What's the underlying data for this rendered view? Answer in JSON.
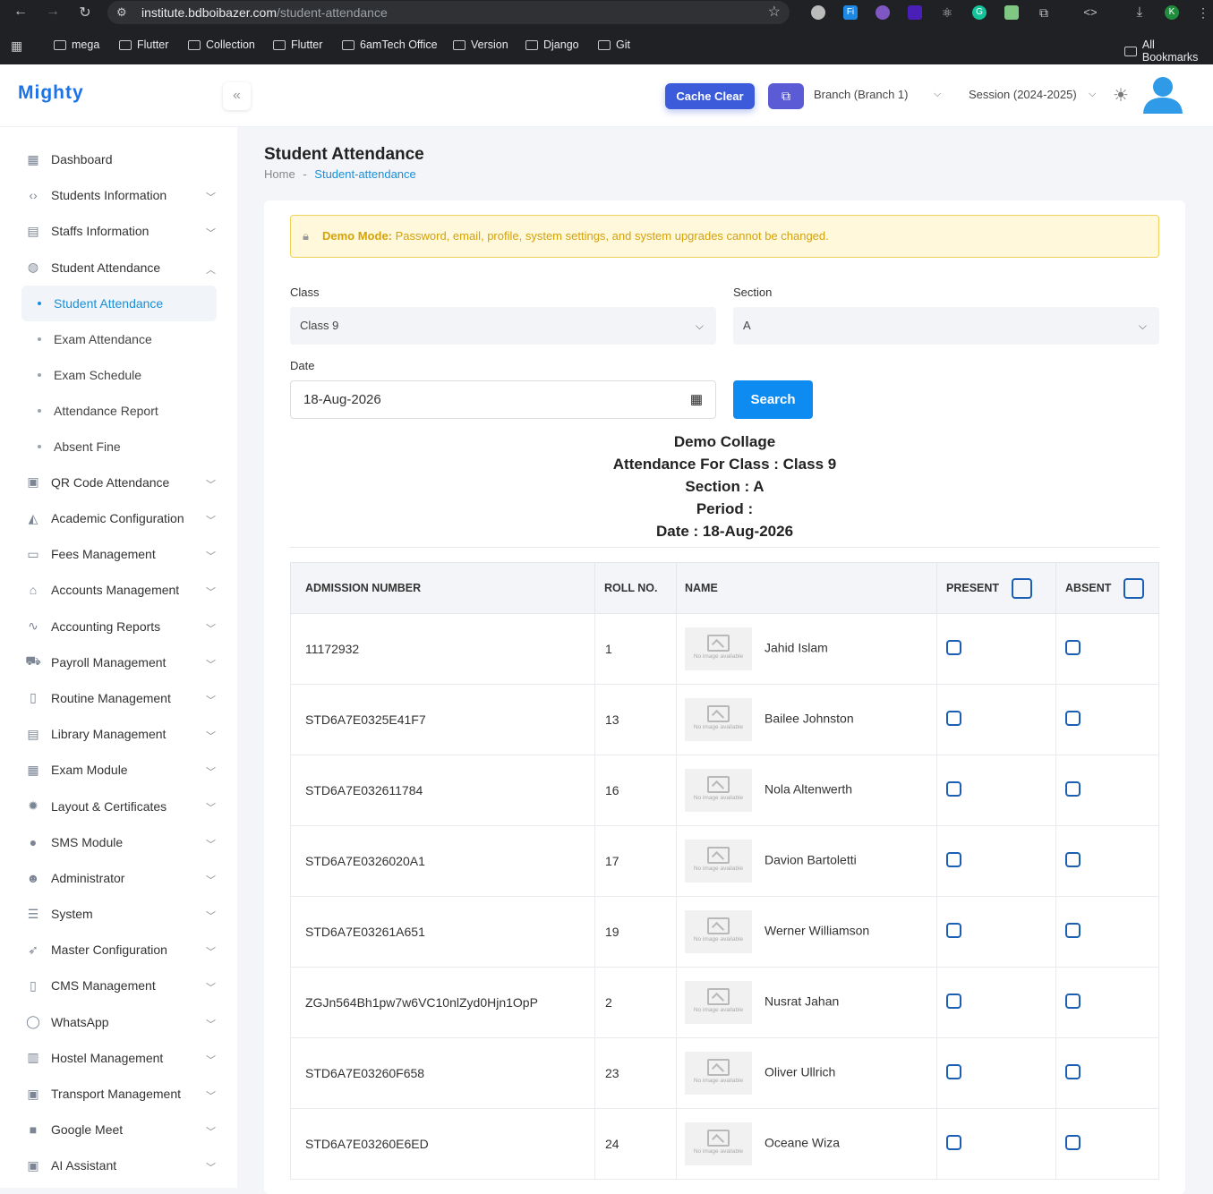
{
  "browser": {
    "url_host": "institute.bdboibazer.com",
    "url_path": "/student-attendance",
    "profile_initial": "K",
    "bookmarks": [
      "mega",
      "Flutter",
      "Collection",
      "Flutter",
      "6amTech Office",
      "Version",
      "Django",
      "Git"
    ],
    "all_bookmarks": "All Bookmarks"
  },
  "app": {
    "logo": "Mighty"
  },
  "sidebar": {
    "items": [
      {
        "label": "Dashboard",
        "icon": "dashboard-icon",
        "chevron": false
      },
      {
        "label": "Students Information",
        "icon": "code-icon",
        "chevron": true
      },
      {
        "label": "Staffs Information",
        "icon": "staff-icon",
        "chevron": true
      },
      {
        "label": "Student Attendance",
        "icon": "attendance-icon",
        "chevron": true,
        "expanded": true
      },
      {
        "label": "QR Code Attendance",
        "icon": "qr-icon",
        "chevron": true
      },
      {
        "label": "Academic Configuration",
        "icon": "academic-icon",
        "chevron": true
      },
      {
        "label": "Fees Management",
        "icon": "fees-icon",
        "chevron": true
      },
      {
        "label": "Accounts Management",
        "icon": "bank-icon",
        "chevron": true
      },
      {
        "label": "Accounting Reports",
        "icon": "chart-icon",
        "chevron": true
      },
      {
        "label": "Payroll Management",
        "icon": "payroll-icon",
        "chevron": true
      },
      {
        "label": "Routine Management",
        "icon": "map-icon",
        "chevron": true
      },
      {
        "label": "Library Management",
        "icon": "library-icon",
        "chevron": true
      },
      {
        "label": "Exam Module",
        "icon": "exam-icon",
        "chevron": true
      },
      {
        "label": "Layout & Certificates",
        "icon": "gear-icon",
        "chevron": true
      },
      {
        "label": "SMS Module",
        "icon": "sms-icon",
        "chevron": true
      },
      {
        "label": "Administrator",
        "icon": "admin-icon",
        "chevron": true
      },
      {
        "label": "System",
        "icon": "server-icon",
        "chevron": true
      },
      {
        "label": "Master Configuration",
        "icon": "rocket-icon",
        "chevron": true
      },
      {
        "label": "CMS Management",
        "icon": "cms-icon",
        "chevron": true
      },
      {
        "label": "WhatsApp",
        "icon": "whatsapp-icon",
        "chevron": true
      },
      {
        "label": "Hostel Management",
        "icon": "building-icon",
        "chevron": true
      },
      {
        "label": "Transport Management",
        "icon": "bus-icon",
        "chevron": true
      },
      {
        "label": "Google Meet",
        "icon": "video-icon",
        "chevron": true
      },
      {
        "label": "AI Assistant",
        "icon": "robot-icon",
        "chevron": true
      }
    ],
    "sub_items": [
      "Student Attendance",
      "Exam Attendance",
      "Exam Schedule",
      "Attendance Report",
      "Absent Fine"
    ]
  },
  "topbar": {
    "cache_clear": "Cache Clear",
    "branch": "Branch (Branch 1)",
    "session": "Session (2024-2025)"
  },
  "page": {
    "title": "Student Attendance",
    "breadcrumb_home": "Home",
    "breadcrumb_sep": "-",
    "breadcrumb_current": "Student-attendance"
  },
  "alert": {
    "label": "Demo Mode:",
    "message": " Password, email, profile, system settings, and system upgrades cannot be changed."
  },
  "form": {
    "class_label": "Class",
    "class_value": "Class 9",
    "section_label": "Section",
    "section_value": "A",
    "date_label": "Date",
    "date_value": "18-Aug-2026",
    "search": "Search"
  },
  "report": {
    "college": "Demo Collage",
    "line_class": "Attendance For Class : Class 9",
    "line_section": "Section : A",
    "line_period": "Period :",
    "line_date": "Date : 18-Aug-2026"
  },
  "table": {
    "headers": [
      "Admission Number",
      "Roll No.",
      "Name",
      "Present",
      "Absent"
    ],
    "no_image": "No image available",
    "rows": [
      {
        "admission": "11172932",
        "roll": "1",
        "name": "Jahid Islam"
      },
      {
        "admission": "STD6A7E0325E41F7",
        "roll": "13",
        "name": "Bailee Johnston"
      },
      {
        "admission": "STD6A7E032611784",
        "roll": "16",
        "name": "Nola Altenwerth"
      },
      {
        "admission": "STD6A7E0326020A1",
        "roll": "17",
        "name": "Davion Bartoletti"
      },
      {
        "admission": "STD6A7E03261A651",
        "roll": "19",
        "name": "Werner Williamson"
      },
      {
        "admission": "ZGJn564Bh1pw7w6VC10nlZyd0Hjn1OpP",
        "roll": "2",
        "name": "Nusrat Jahan"
      },
      {
        "admission": "STD6A7E03260F658",
        "roll": "23",
        "name": "Oliver Ullrich"
      },
      {
        "admission": "STD6A7E03260E6ED",
        "roll": "24",
        "name": "Oceane Wiza"
      }
    ]
  }
}
